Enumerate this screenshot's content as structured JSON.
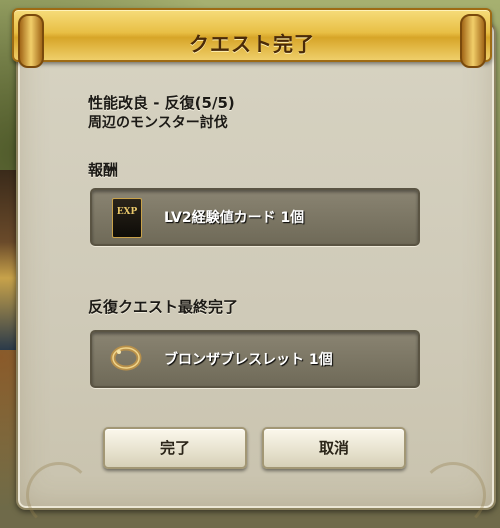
{
  "dialog": {
    "title": "クエスト完了",
    "quest_name": "性能改良 - 反復(5/5)",
    "quest_objective": "周辺のモンスター討伐",
    "reward_heading": "報酬",
    "reward_item": {
      "icon": "exp-card-icon",
      "icon_text": "EXP",
      "name": "LV2経験値カード 1個"
    },
    "final_heading": "反復クエスト最終完了",
    "final_item": {
      "icon": "bronze-bracelet-icon",
      "name": "ブロンザブレスレット 1個"
    },
    "buttons": {
      "complete": "完了",
      "cancel": "取消"
    }
  },
  "colors": {
    "banner": "#e8bf45",
    "panel": "#d2cdbb",
    "slot": "#7a7462"
  }
}
